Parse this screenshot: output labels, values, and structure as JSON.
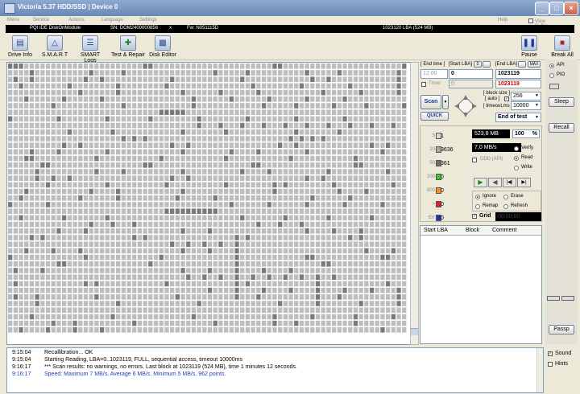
{
  "window": {
    "title": "Victoria 5.37 HDD/SSD  |  Device 0",
    "buttons": [
      "_",
      "□",
      "×"
    ]
  },
  "menu": {
    "items": [
      "Menu",
      "Service",
      "Actions",
      "Language",
      "Settings",
      "Help"
    ],
    "view_buffer": "View Buffer Live"
  },
  "device_bar": {
    "model": "PQI IDE DiskOnModule",
    "serial": "SN: DOM2400000856",
    "close": "x",
    "firmware": "Fw: N051115D",
    "capacity": "1023120 LBA (524 MB)"
  },
  "toolbar": {
    "buttons": [
      {
        "label": "Drive Info",
        "icon": "drive-info-icon"
      },
      {
        "label": "S.M.A.R.T",
        "icon": "smart-icon"
      },
      {
        "label": "SMART Logs",
        "icon": "smart-logs-icon"
      },
      {
        "label": "Test & Repair",
        "icon": "test-repair-icon"
      },
      {
        "label": "Disk Editor",
        "icon": "disk-editor-icon"
      }
    ],
    "pause": "Pause",
    "break_all": "Break All"
  },
  "scan_panel": {
    "end_time_label": "[ End time ]",
    "start_lba_label": "[Start LBA]",
    "end_lba_label": "[End LBA]",
    "max_label": "MAX",
    "zero_btn": "0",
    "end_time_value": "12:00",
    "start_lba_value": "0",
    "end_lba_value": "1023119",
    "timer_label": "Timer",
    "timer_value": "0",
    "end_lba_value2": "1023119",
    "scan_btn": "Scan",
    "quick_btn": "QUICK",
    "block_size_label": "[ block size ]",
    "auto_label": "[ auto ]",
    "block_size_value": "256",
    "timeout_label": "[ timeout,ms ]",
    "timeout_value": "10000",
    "end_mode": "End of test"
  },
  "stats": {
    "blocks": [
      {
        "label": "5",
        "value": "1",
        "color": "#d8d8d8"
      },
      {
        "label": "20",
        "value": "3636",
        "color": "#a8a8a8"
      },
      {
        "label": "50",
        "value": "361",
        "color": "#6e6e6e"
      },
      {
        "label": "200",
        "value": "0",
        "color": "#33cc33"
      },
      {
        "label": "600",
        "value": "0",
        "color": "#ff8c1a"
      },
      {
        "label": ">",
        "value": "0",
        "color": "#e02020"
      },
      {
        "label": "Err",
        "value": "0",
        "color": "#2030c0"
      }
    ],
    "size_read": "523,8 MB",
    "percent": "100",
    "percent_unit": "%",
    "speed": "7,0 MB/s",
    "ddd": "DDD (API)",
    "modes": [
      "Verify",
      "Read",
      "Write"
    ],
    "selected_mode": "Read",
    "actions": [
      "Ignore",
      "Erase",
      "Remap",
      "Refresh"
    ],
    "selected_action": "Ignore",
    "grid_label": "Grid",
    "grid_time": "00:00:00"
  },
  "table": {
    "columns": [
      "Start LBA",
      "Block",
      "Comment"
    ]
  },
  "right_panel": {
    "api": "API",
    "pio": "PIO",
    "selected": "API",
    "sleep": "Sleep",
    "recall": "Recall",
    "passp": "Passp"
  },
  "log": {
    "lines": [
      {
        "time": "9:15:04",
        "text": "Recallibration... OK",
        "color": "#000000"
      },
      {
        "time": "9:15:04",
        "text": "Starting Reading, LBA=0..1023119, FULL, sequential access, timeout 10000ms",
        "color": "#000000"
      },
      {
        "time": "9:16:17",
        "text": "*** Scan results: no warnings, no errors. Last block at 1023119 (524 MB), time 1 minutes 12 seconds.",
        "color": "#000000"
      },
      {
        "time": "9:16:17",
        "text": "Speed: Maximum 7 MB/s. Average 6 MB/s. Minimum 5 MB/s. 962 points.",
        "color": "#2040c0"
      }
    ],
    "sound": "Sound",
    "hints": "Hints"
  },
  "colors": {
    "accent": "#6a88b8",
    "grid_light": "#bdbdbd",
    "grid_dark": "#7a7a7a"
  }
}
